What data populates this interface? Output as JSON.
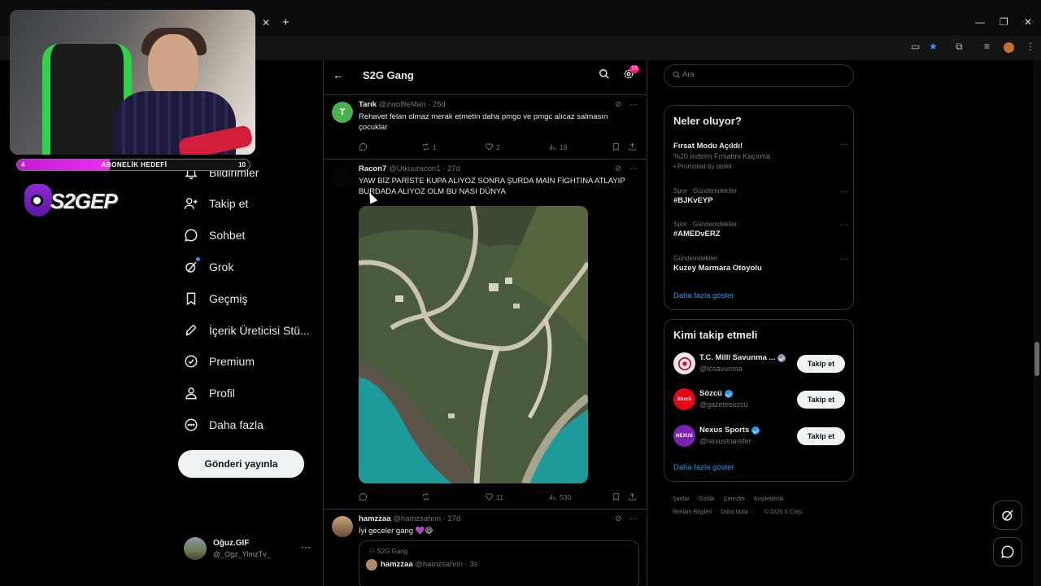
{
  "browser": {
    "tab_close": "✕",
    "new_tab": "+",
    "window_controls": [
      "—",
      "❐",
      "✕"
    ]
  },
  "stream_overlay": {
    "subscriber_goal": {
      "label": "ABONELİK HEDEFİ",
      "current": "4",
      "target": "10",
      "progress_fraction": 0.4
    },
    "logo_text": "S2GEP",
    "accent_color": "#e02cf0"
  },
  "nav": {
    "notifications_badge": "2",
    "items": [
      {
        "label": "Bildirimler",
        "icon": "bell-icon"
      },
      {
        "label": "Takip et",
        "icon": "person-add-icon"
      },
      {
        "label": "Sohbet",
        "icon": "chat-icon"
      },
      {
        "label": "Grok",
        "icon": "grok-icon"
      },
      {
        "label": "Geçmiş",
        "icon": "bookmark-icon"
      },
      {
        "label": "İçerik Üreticisi Stü...",
        "icon": "rocket-icon"
      },
      {
        "label": "Premium",
        "icon": "premium-icon"
      },
      {
        "label": "Profil",
        "icon": "profile-icon"
      },
      {
        "label": "Daha fazla",
        "icon": "more-circle-icon"
      }
    ],
    "post_button": "Gönderi yayınla",
    "account": {
      "name": "Oğuz.GIF",
      "handle": "@_Ogz_YlmzTv_",
      "more": "···"
    }
  },
  "community": {
    "back": "←",
    "title": "S2G Gang",
    "settings_badge": "15"
  },
  "tweets": [
    {
      "name": "Tarık",
      "handle": "@zwolfteMan",
      "time": "· 26d",
      "avatar_letter": "T",
      "avatar_color": "#4caf50",
      "text": "Rehavet felan olmaz merak etmetin daha pmgo ve pmgc alıcaz salmasın çocuklar",
      "replies": "",
      "reposts": "1",
      "likes": "2",
      "views": "18"
    },
    {
      "name": "Racon7",
      "handle": "@Utkuuracon1",
      "time": "· 27d",
      "text": "YAW BİZ PARİSTE KUPA ALIYOZ SONRA ŞURDA MAİN FİGHTINA ATLAYIP BURDADA ALIYOZ OLM BU NASI DÜNYA",
      "replies": "",
      "reposts": "",
      "likes": "11",
      "views": "530"
    },
    {
      "name": "hamzzaa",
      "handle": "@hamzsahnn",
      "time": "· 27d",
      "text": "İyi geceler gang 💜😄",
      "quote": {
        "community": "S2G Gang",
        "name": "hamzzaa",
        "handle": "@hamzsahnn",
        "time": "· 3s"
      }
    }
  ],
  "right": {
    "search_placeholder": "Ara",
    "trends_title": "Neler oluyor?",
    "trends": [
      {
        "category": "",
        "name": "Fırsat Modu Açıldı!",
        "sub": "%20 İndirim Fırsatını Kaçırma",
        "promo": "Promoted by obilet"
      },
      {
        "category": "Spor · Gündemdekiler",
        "name": "#BJKvEYP"
      },
      {
        "category": "Spor · Gündemdekiler",
        "name": "#AMEDvERZ"
      },
      {
        "category": "Gündemdekiler",
        "name": "Kuzey Marmara Otoyolu"
      }
    ],
    "trends_more": "Daha fazla göster",
    "follow_title": "Kimi takip etmeli",
    "suggestions": [
      {
        "name": "T.C. Millî Savunma ...",
        "handle": "@tcsavunma",
        "avatar_text": "",
        "avatar_color": "#e8e8e8",
        "verified": "gray"
      },
      {
        "name": "Sözcü",
        "handle": "@gazetesozcu",
        "avatar_text": "Sözcü",
        "avatar_color": "#e30613",
        "verified": "blue"
      },
      {
        "name": "Nexus Sports",
        "handle": "@nexustransfer",
        "avatar_text": "NEXUS",
        "avatar_color": "#7a22b5",
        "verified": "blue"
      }
    ],
    "follow_button": "Takip et",
    "follow_more": "Daha fazla göster",
    "footer": [
      "Şartlar",
      "Gizlilik",
      "Çerezler",
      "Erişilebilirlik",
      "Reklam Bilgileri",
      "Daha fazla ···",
      "© 2026 X Corp."
    ]
  }
}
